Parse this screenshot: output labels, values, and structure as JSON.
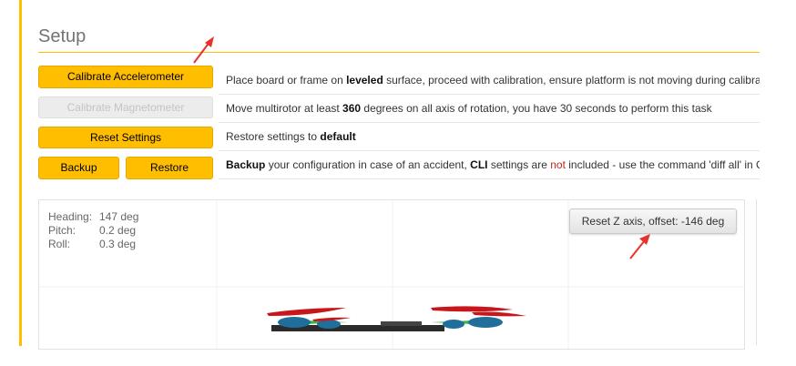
{
  "title": "Setup",
  "buttons": {
    "calibrate_accelerometer": "Calibrate Accelerometer",
    "calibrate_magnetometer": "Calibrate Magnetometer",
    "reset_settings": "Reset Settings",
    "backup": "Backup",
    "restore": "Restore"
  },
  "descriptions": {
    "accelerometer": {
      "pre": "Place board or frame on ",
      "bold": "leveled",
      "post": " surface, proceed with calibration, ensure platform is not moving during calibra"
    },
    "magnetometer": {
      "pre": "Move multirotor at least ",
      "bold": "360",
      "post": " degrees on all axis of rotation, you have 30 seconds to perform this task"
    },
    "reset": {
      "pre": "Restore settings to ",
      "bold": "default"
    },
    "backup": {
      "bold1": "Backup",
      "mid1": " your configuration in case of an accident, ",
      "bold2": "CLI",
      "mid2": " settings are ",
      "red": "not",
      "post": " included - use the command 'diff all' in CL"
    }
  },
  "attitude": {
    "heading_label": "Heading:",
    "heading_value": "147 deg",
    "pitch_label": "Pitch:",
    "pitch_value": "0.2 deg",
    "roll_label": "Roll:",
    "roll_value": "0.3 deg"
  },
  "reset_z_button": "Reset Z axis, offset: -146 deg",
  "colors": {
    "accent": "#ffbe00",
    "arrow": "#e8322b",
    "propeller": "#c8171c",
    "motor": "#1f6f9a",
    "arm_green": "#3bb54a",
    "frame": "#2b2b2b"
  }
}
